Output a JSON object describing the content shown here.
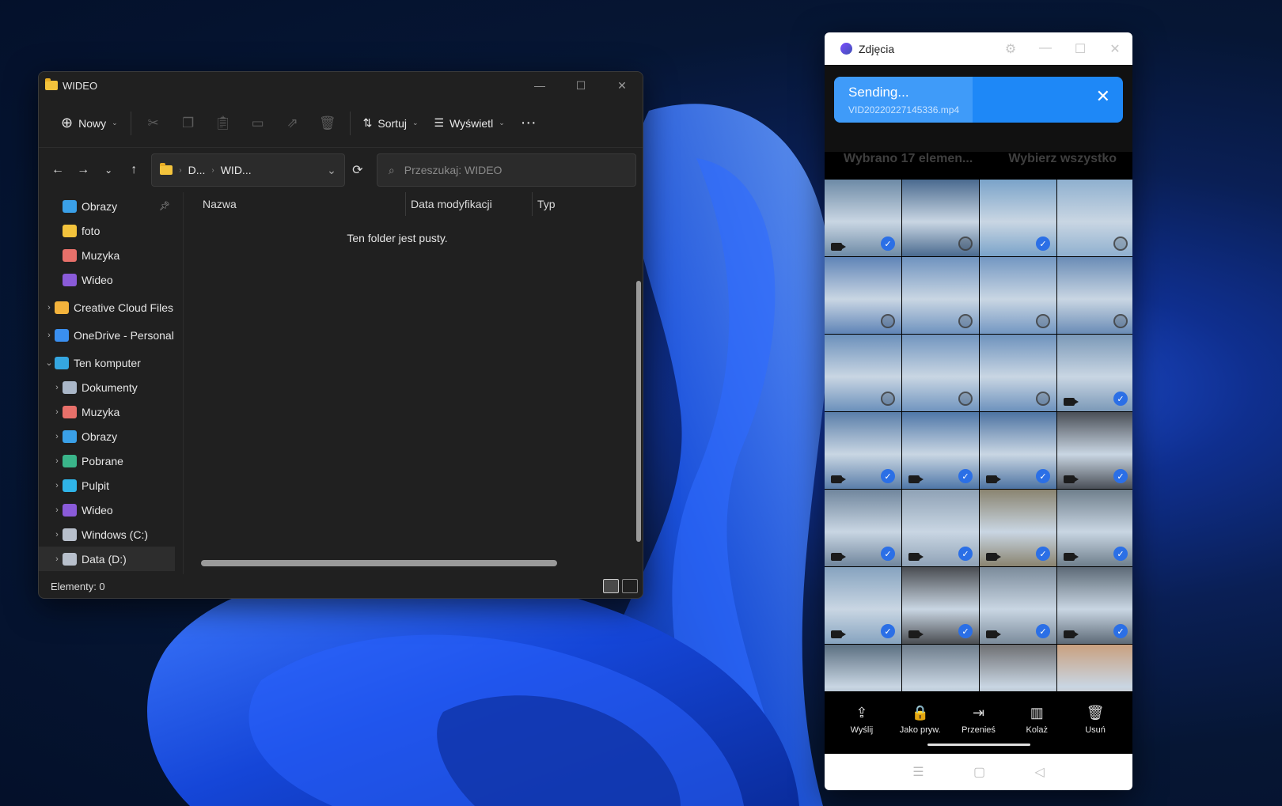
{
  "explorer": {
    "title": "WIDEO",
    "toolbar": {
      "new_label": "Nowy",
      "sort_label": "Sortuj",
      "view_label": "Wyświetl"
    },
    "address": {
      "segments": [
        "D...",
        "WID..."
      ]
    },
    "search": {
      "placeholder": "Przeszukaj: WIDEO"
    },
    "nav": [
      {
        "label": "Obrazy",
        "icon": "pictures-icon",
        "level": 1,
        "pinned": true
      },
      {
        "label": "foto",
        "icon": "folder-icon",
        "level": 1
      },
      {
        "label": "Muzyka",
        "icon": "music-icon",
        "level": 1
      },
      {
        "label": "Wideo",
        "icon": "video-icon",
        "level": 1
      },
      {
        "label": "Creative Cloud Files",
        "icon": "creative-cloud-icon",
        "level": 0,
        "expandable": true
      },
      {
        "label": "OneDrive - Personal",
        "icon": "onedrive-icon",
        "level": 0,
        "expandable": true
      },
      {
        "label": "Ten komputer",
        "icon": "computer-icon",
        "level": 0,
        "expanded": true
      },
      {
        "label": "Dokumenty",
        "icon": "documents-icon",
        "level": 1,
        "expandable": true
      },
      {
        "label": "Muzyka",
        "icon": "music-icon",
        "level": 1,
        "expandable": true
      },
      {
        "label": "Obrazy",
        "icon": "pictures-icon",
        "level": 1,
        "expandable": true
      },
      {
        "label": "Pobrane",
        "icon": "downloads-icon",
        "level": 1,
        "expandable": true
      },
      {
        "label": "Pulpit",
        "icon": "desktop-icon",
        "level": 1,
        "expandable": true
      },
      {
        "label": "Wideo",
        "icon": "video-icon",
        "level": 1,
        "expandable": true
      },
      {
        "label": "Windows (C:)",
        "icon": "drive-icon",
        "level": 1,
        "expandable": true
      },
      {
        "label": "Data (D:)",
        "icon": "drive-icon",
        "level": 1,
        "expandable": true,
        "selected": true
      }
    ],
    "columns": [
      "Nazwa",
      "Data modyfikacji",
      "Typ"
    ],
    "empty_message": "Ten folder jest pusty.",
    "status": "Elementy: 0"
  },
  "phone": {
    "app_title": "Zdjęcia",
    "header_dim": "Wybrano 17 elemen...",
    "header_select_all": "Wybierz wszystko",
    "toast": {
      "title": "Sending...",
      "file": "VID20220227145336.mp4",
      "progress": 0.48
    },
    "grid": [
      {
        "c": "#6d8aa6",
        "v": true,
        "s": true
      },
      {
        "c": "#4a6a8f",
        "v": false,
        "s": false
      },
      {
        "c": "#7aa3c9",
        "v": false,
        "s": true
      },
      {
        "c": "#8fb0cf",
        "v": false,
        "s": false
      },
      {
        "c": "#5f84b7",
        "v": false,
        "s": false
      },
      {
        "c": "#6f93bf",
        "v": false,
        "s": false
      },
      {
        "c": "#7397c2",
        "v": false,
        "s": false
      },
      {
        "c": "#6a8cb6",
        "v": false,
        "s": false
      },
      {
        "c": "#6b90bb",
        "v": false,
        "s": false
      },
      {
        "c": "#7195bf",
        "v": false,
        "s": false
      },
      {
        "c": "#6d92bd",
        "v": false,
        "s": false
      },
      {
        "c": "#7b99b8",
        "v": true,
        "s": true
      },
      {
        "c": "#5a7ea9",
        "v": true,
        "s": true
      },
      {
        "c": "#4f77a8",
        "v": true,
        "s": true
      },
      {
        "c": "#4d73a2",
        "v": true,
        "s": true
      },
      {
        "c": "#4a4f57",
        "v": true,
        "s": true
      },
      {
        "c": "#70869d",
        "v": true,
        "s": true
      },
      {
        "c": "#8fa2b6",
        "v": true,
        "s": true
      },
      {
        "c": "#8a8470",
        "v": true,
        "s": true
      },
      {
        "c": "#6f7f8c",
        "v": true,
        "s": true
      },
      {
        "c": "#86a3bf",
        "v": true,
        "s": true
      },
      {
        "c": "#4a4d52",
        "v": true,
        "s": true
      },
      {
        "c": "#7b8b9b",
        "v": true,
        "s": true
      },
      {
        "c": "#5d6a77",
        "v": true,
        "s": true
      },
      {
        "c": "#5b6f81",
        "v": true,
        "s": true
      },
      {
        "c": "#6e7d8c",
        "v": true,
        "s": true
      },
      {
        "c": "#6e6f72",
        "v": false,
        "s": false
      },
      {
        "c": "#c9a07f",
        "v": false,
        "s": false
      }
    ],
    "actions": [
      {
        "label": "Wyślij",
        "icon": "share-icon",
        "glyph": "⇪"
      },
      {
        "label": "Jako pryw.",
        "icon": "lock-icon",
        "glyph": "🔒"
      },
      {
        "label": "Przenieś",
        "icon": "move-icon",
        "glyph": "⇥"
      },
      {
        "label": "Kolaż",
        "icon": "collage-icon",
        "glyph": "▥"
      },
      {
        "label": "Usuń",
        "icon": "trash-icon",
        "glyph": "🗑"
      }
    ]
  },
  "colors": {
    "accent": "#2b6fe6",
    "toast": "#1e88f7",
    "explorer_bg": "#202020"
  }
}
